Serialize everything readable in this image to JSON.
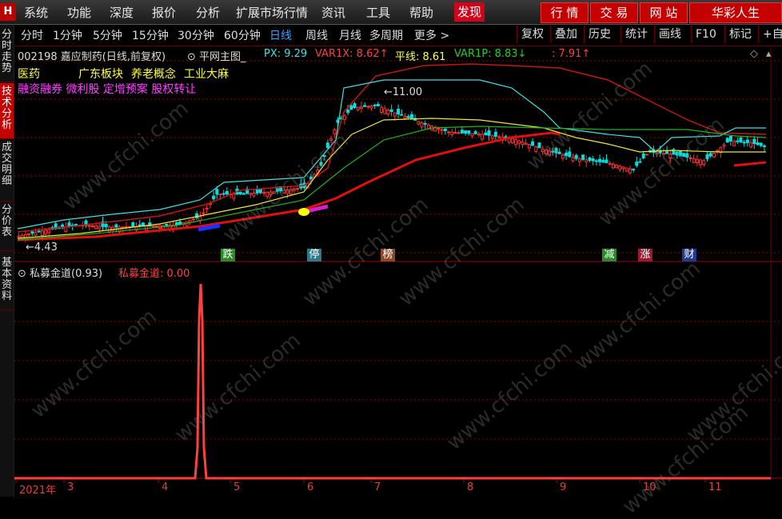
{
  "logo": "H",
  "menu": [
    "系统",
    "功能",
    "深度",
    "报价",
    "分析",
    "扩展市场行情",
    "资讯",
    "工具",
    "帮助"
  ],
  "menu_highlight": "发现",
  "right_buttons": [
    "行 情",
    "交 易",
    "网 站",
    "华彩人生"
  ],
  "periods": [
    "分时",
    "1分钟",
    "5分钟",
    "15分钟",
    "30分钟",
    "60分钟",
    "日线",
    "周线",
    "月线",
    "多周期",
    "更多 >"
  ],
  "active_period": "日线",
  "toolbar_right": [
    "复权",
    "叠加",
    "历史",
    "统计",
    "画线",
    "F10",
    "标记",
    "+自"
  ],
  "left_tabs": [
    {
      "label": "分时走势",
      "active": false
    },
    {
      "label": "技术分析",
      "active": true
    },
    {
      "label": "成交明细",
      "active": false
    },
    {
      "label": "分价表",
      "active": false
    },
    {
      "label": "基本资料",
      "active": false
    }
  ],
  "stock": {
    "code_name": "002198 嘉应制药(日线,前复权)",
    "indicator": "平网主图_",
    "px": "PX: 9.29",
    "var1x": "VAR1X: 8.62↑",
    "pingxian": "平线: 8.61",
    "var1p": "VAR1P: 8.83↓",
    "extra": ": 7.91↑"
  },
  "concepts_line1": [
    "医药",
    "广东板块",
    "养老概念",
    "工业大麻"
  ],
  "concepts_line2": "融资融券 微利股 定增预案 股权转让",
  "annotations": {
    "high": "←11.00",
    "low": "←4.43"
  },
  "signals": [
    {
      "label": "跌",
      "color": "#2a8a2a"
    },
    {
      "label": "停",
      "color": "#2a7a8a"
    },
    {
      "label": "榜",
      "color": "#8a4a2a"
    },
    {
      "label": "减",
      "color": "#2a8a2a"
    },
    {
      "label": "涨",
      "color": "#a01830"
    },
    {
      "label": "财",
      "color": "#203a90"
    }
  ],
  "sub_indicator": {
    "name": "私募金道(0.93)",
    "value": "私募金道: 0.00"
  },
  "x_axis": [
    "2021年",
    "3",
    "4",
    "5",
    "6",
    "7",
    "8",
    "9",
    "10",
    "11"
  ],
  "watermark": "www.cfchi.com",
  "colors": {
    "up": "#ff3030",
    "down": "#00e0e0",
    "ma_red": "#e01010",
    "ma_yellow": "#e8e840",
    "ma_green": "#20b020",
    "ma_cyan": "#40e0e0",
    "grid": "#8a0000"
  }
}
